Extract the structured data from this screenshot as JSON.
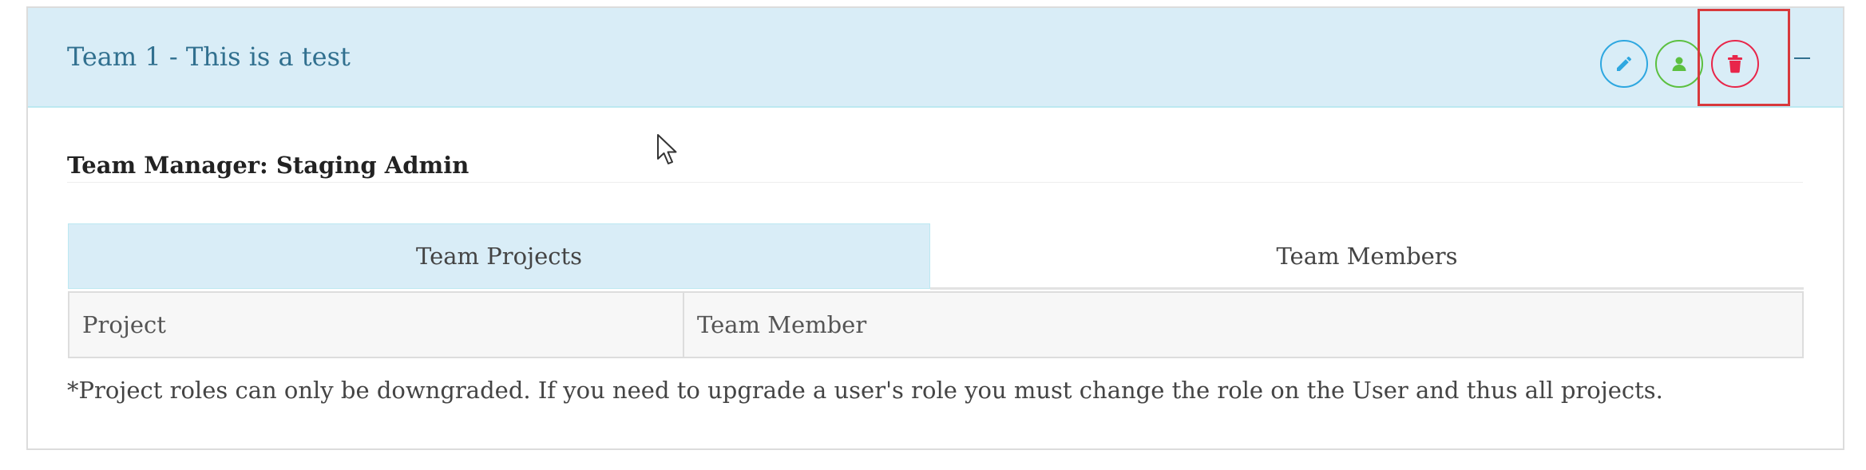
{
  "team": {
    "title": "Team 1 - This is a test",
    "manager_text": "Team Manager: Staging Admin"
  },
  "actions": {
    "edit_icon": "pencil-icon",
    "user_icon": "user-icon",
    "delete_icon": "trash-icon",
    "collapse_icon": "minus-icon"
  },
  "tabs": [
    {
      "label": "Team Projects",
      "active": true
    },
    {
      "label": "Team Members",
      "active": false
    }
  ],
  "table": {
    "headers": [
      "Project",
      "Team Member"
    ]
  },
  "footnote": "*Project roles can only be downgraded. If you need to upgrade a user's role you must change the role on the User and thus all projects.",
  "colors": {
    "heading_bg": "#d9edf7",
    "heading_text": "#31708f",
    "edit": "#2ea7e0",
    "user": "#5cc040",
    "delete": "#e8264a",
    "highlight": "#d8393c"
  }
}
